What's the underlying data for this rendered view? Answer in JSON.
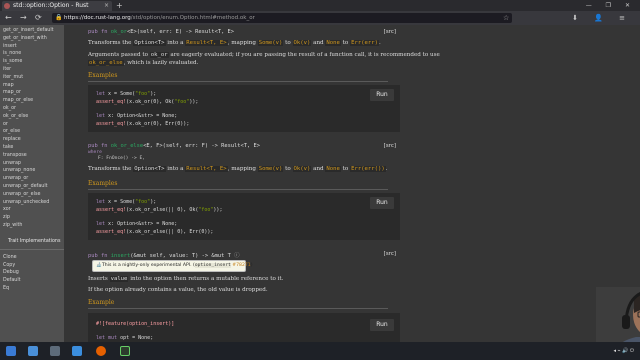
{
  "browser": {
    "tab_title": "std::option::Option - Rust",
    "tab_close": "×",
    "new_tab": "+",
    "window_controls": "— ❐ ✕",
    "url_host": "https://doc.rust-lang.org",
    "url_path": "/std/option/enum.Option.html#method.ok_or",
    "nav": {
      "back": "←",
      "forward": "→",
      "reload": "⟳"
    },
    "star": "☆",
    "right_icons": "⬇ 👤 ≡"
  },
  "sidebar": {
    "items": [
      "get_or_insert_default",
      "get_or_insert_with",
      "insert",
      "is_none",
      "is_some",
      "iter",
      "iter_mut",
      "map",
      "map_or",
      "map_or_else",
      "ok_or",
      "ok_or_else",
      "or",
      "or_else",
      "replace",
      "take",
      "transpose",
      "unwrap",
      "unwrap_none",
      "unwrap_or",
      "unwrap_or_default",
      "unwrap_or_else",
      "unwrap_unchecked",
      "xor",
      "zip",
      "zip_with"
    ],
    "section_heading": "Trait Implementations",
    "traits": [
      "Clone",
      "Copy",
      "Debug",
      "Default",
      "Eq"
    ]
  },
  "ok_or": {
    "sig_pub_fn": "pub fn ",
    "sig_name": "ok_or",
    "sig_rest": "<E>(self, err: E) -> Result<T, E>",
    "src": "[src]",
    "desc": {
      "t1": "Transforms the ",
      "c1": "Option<T>",
      "t2": " into a ",
      "c2": "Result<T, E>",
      "t3": ", mapping ",
      "c3": "Some(v)",
      "t4": " to ",
      "c4": "Ok(v)",
      "t5": " and ",
      "c5": "None",
      "t6": " to ",
      "c6": "Err(err)",
      "t7": "."
    },
    "note_line1_a": "Arguments passed to ",
    "note_line1_code": "ok_or",
    "note_line1_b": " are eagerly evaluated; if you are passing the result of a function call, it is recommended to use",
    "note_line2_code": "ok_or_else",
    "note_line2_b": ", which is lazily evaluated.",
    "examples": "Examples",
    "code": [
      "let x = Some(\"foo\");",
      "assert_eq!(x.ok_or(0), Ok(\"foo\"));",
      "let x: Option<&str> = None;",
      "assert_eq!(x.ok_or(0), Err(0));"
    ],
    "run": "Run"
  },
  "ok_or_else": {
    "sig_pub_fn": "pub fn ",
    "sig_name": "ok_or_else",
    "sig_rest": "<E, F>(self, err: F) -> Result<T, E>",
    "where": "where",
    "where_bound": "F: FnOnce() -> E,",
    "src": "[src]",
    "desc": {
      "t1": "Transforms the ",
      "c1": "Option<T>",
      "t2": " into a ",
      "c2": "Result<T, E>",
      "t3": ", mapping ",
      "c3": "Some(v)",
      "t4": " to ",
      "c4": "Ok(v)",
      "t5": " and ",
      "c5": "None",
      "t6": " to ",
      "c6": "Err(err())",
      "t7": "."
    },
    "examples": "Examples",
    "code": [
      "let x = Some(\"foo\");",
      "assert_eq!(x.ok_or_else(|| 0), Ok(\"foo\"));",
      "let x: Option<&str> = None;",
      "assert_eq!(x.ok_or_else(|| 0), Err(0));"
    ],
    "run": "Run"
  },
  "insert": {
    "sig_pub_fn": "pub fn ",
    "sig_name": "insert",
    "sig_rest": "(&mut self, value: T) -> &mut T",
    "info_icon": "ⓘ",
    "src": "[src]",
    "tooltip_icon": "🔬",
    "tooltip_text": "This is a nightly-only experimental API. (",
    "tooltip_feature": "option_insert",
    "tooltip_issue": "#78271",
    "tooltip_close": ")",
    "desc1_a": "Inserts ",
    "desc1_code": "value",
    "desc1_b": " into the option then returns a mutable reference to it.",
    "desc2": "If the option already contains a value, the old value is dropped.",
    "examples": "Example",
    "code": [
      "#![feature(option_insert)]",
      "let mut opt = None;"
    ],
    "run": "Run"
  },
  "taskbar": {
    "tray_text": "◂ ⌁ 🔊 ⏻"
  }
}
